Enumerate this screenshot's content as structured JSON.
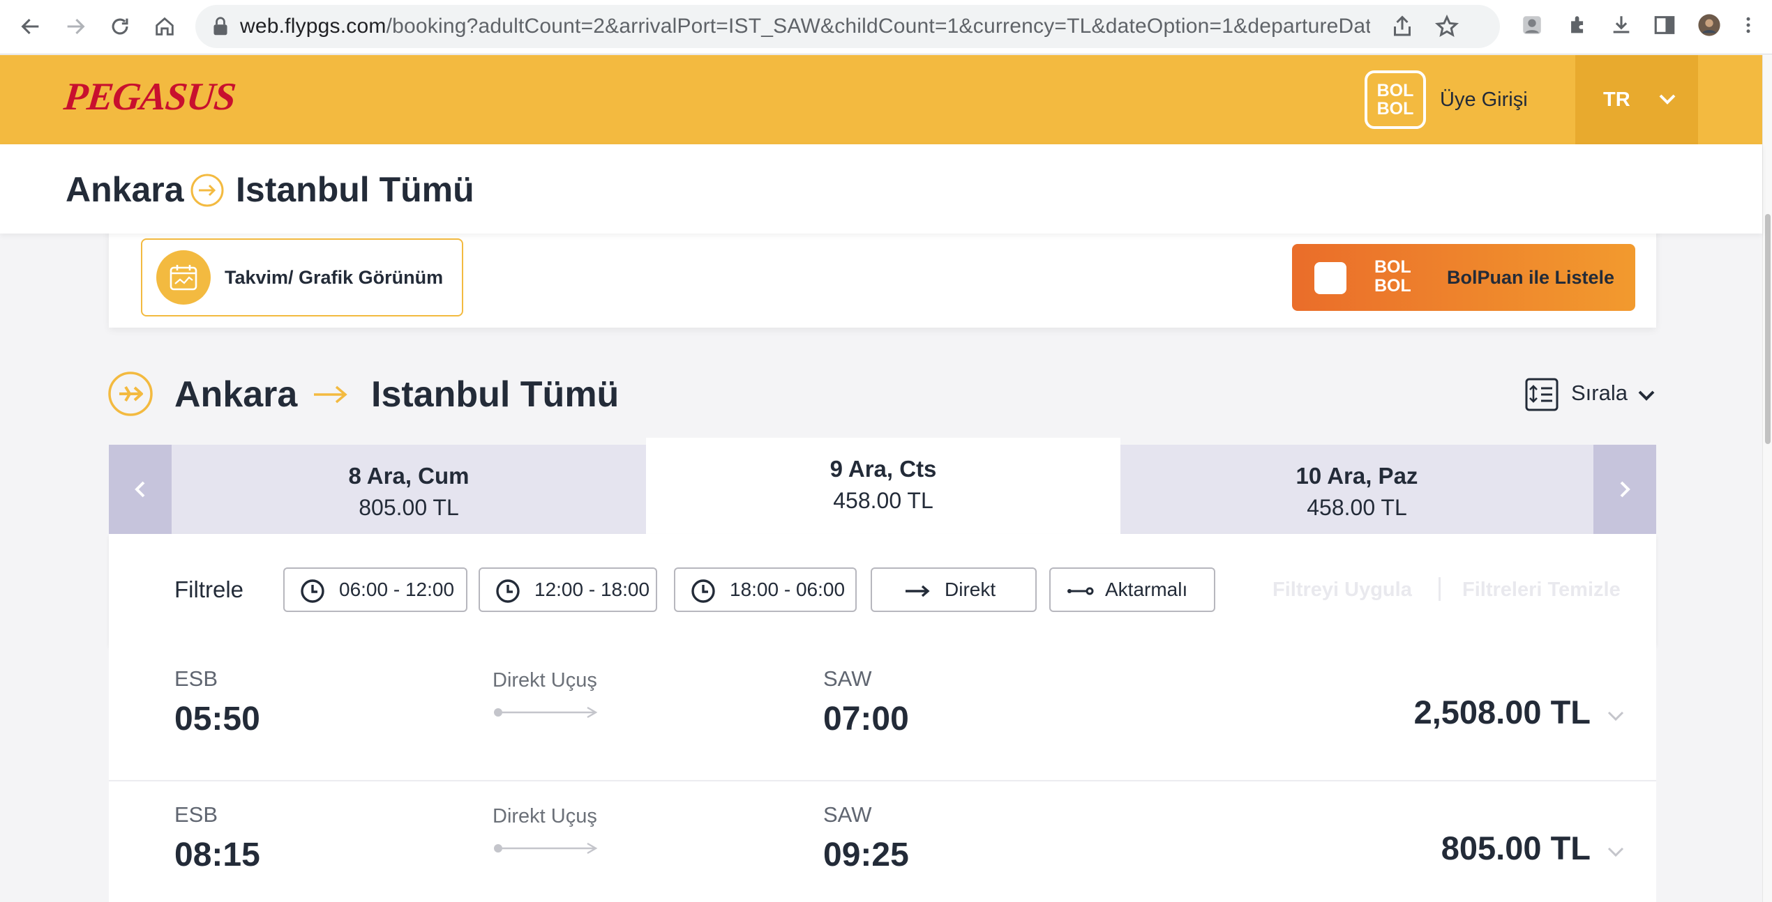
{
  "browser": {
    "url_host": "web.flypgs.com",
    "url_rest": "/booking?adultCount=2&arrivalPort=IST_SAW&childCount=1&currency=TL&dateOption=1&departureDate=2..."
  },
  "header": {
    "logo": "PEGASUS",
    "bolbol_badge_top": "BOL",
    "bolbol_badge_bottom": "BOL",
    "login_label": "Üye Girişi",
    "language": "TR",
    "accent_color": "#f3ba40",
    "logo_color": "#c8102e"
  },
  "route": {
    "from": "Ankara",
    "to": "Istanbul Tümü"
  },
  "controls": {
    "calendar_view_label": "Takvim/ Grafik Görünüm",
    "bolpuan_badge_top": "BOL",
    "bolpuan_badge_bottom": "BOL",
    "bolpuan_label": "BolPuan ile Listele"
  },
  "section": {
    "from": "Ankara",
    "to": "Istanbul Tümü",
    "sort_label": "Sırala"
  },
  "dates": [
    {
      "date": "8 Ara, Cum",
      "price": "805.00 TL"
    },
    {
      "date": "9 Ara, Cts",
      "price": "458.00 TL",
      "active": true
    },
    {
      "date": "10 Ara, Paz",
      "price": "458.00 TL"
    }
  ],
  "filters": {
    "title": "Filtrele",
    "chips": [
      "06:00 - 12:00",
      "12:00 - 18:00",
      "18:00 - 06:00",
      "Direkt",
      "Aktarmalı"
    ],
    "apply_label": "Filtreyi Uygula",
    "clear_label": "Filtreleri Temizle"
  },
  "flights": [
    {
      "dep_code": "ESB",
      "dep_time": "05:50",
      "type": "Direkt Uçuş",
      "arr_code": "SAW",
      "arr_time": "07:00",
      "price": "2,508.00 TL"
    },
    {
      "dep_code": "ESB",
      "dep_time": "08:15",
      "type": "Direkt Uçuş",
      "arr_code": "SAW",
      "arr_time": "09:25",
      "price": "805.00 TL"
    }
  ]
}
